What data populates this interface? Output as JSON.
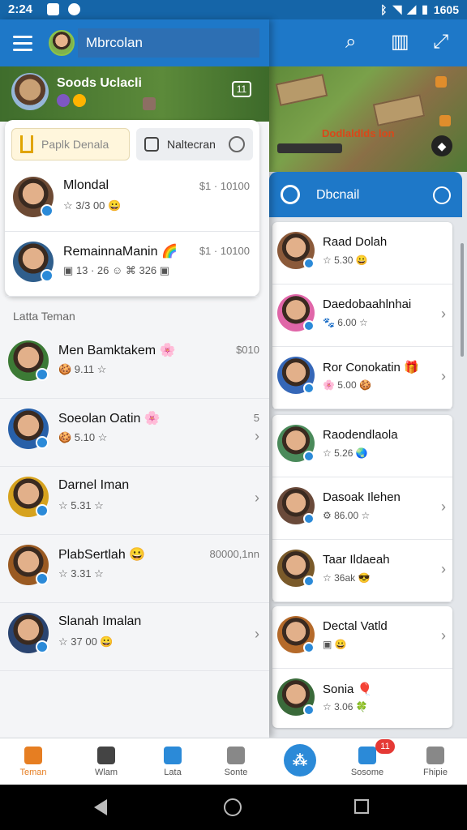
{
  "status_bar": {
    "time": "2:24",
    "right_text": "1605"
  },
  "drawer": {
    "search_text": "Mbrcolan",
    "banner_title": "Soods Uclacli",
    "banner_badge": "11",
    "tabs": [
      {
        "label": "Paplk Denala"
      },
      {
        "label": "Naltecran"
      }
    ],
    "pinned": [
      {
        "name": "Mlondal",
        "meta": "☆ 3/3 00 😀",
        "right": "$1 · 10100",
        "avatar_color": "#6d4a34"
      },
      {
        "name": "RemainnaManin 🌈",
        "meta": "▣ 13 · 26 ☺ ⌘ 326 ▣",
        "right": "$1 · 10100",
        "avatar_color": "#2f5e8c"
      }
    ],
    "section_label": "Latta Teman",
    "friends": [
      {
        "name": "Men Bamktakem 🌸",
        "meta": "🍪 9.11 ☆",
        "right": "$010",
        "chevron": false,
        "avatar_color": "#3c7a35"
      },
      {
        "name": "Soeolan Oatin 🌸",
        "meta": "🍪 5.10 ☆",
        "right": "5",
        "chevron": true,
        "avatar_color": "#2860a8"
      },
      {
        "name": "Darnel Iman",
        "meta": "☆ 5.31 ☆",
        "right": "",
        "chevron": true,
        "avatar_color": "#d6a21e"
      },
      {
        "name": "PlabSertlah 😀",
        "meta": "☆ 3.31 ☆",
        "right": "80000,1nn",
        "chevron": false,
        "avatar_color": "#9a5a22"
      },
      {
        "name": "Slanah Imalan",
        "meta": "☆ 37 00 😀",
        "right": "",
        "chevron": true,
        "avatar_color": "#2a4470"
      }
    ]
  },
  "right_panel": {
    "title": "Dbcnail",
    "game_text": "Dodlaldlds lon",
    "card1": [
      {
        "name": "Raad Dolah",
        "meta": "☆ 5.30 😀",
        "chevron": false,
        "avatar_color": "#8b5a3a"
      },
      {
        "name": "Daedobaahlnhai",
        "meta": "🐾 6.00 ☆",
        "chevron": true,
        "avatar_color": "#e066a8"
      },
      {
        "name": "Ror Conokatin 🎁",
        "meta": "🌸 5.00 🍪",
        "chevron": true,
        "avatar_color": "#3567b8"
      }
    ],
    "card2": [
      {
        "name": "Raodendlaola",
        "meta": "☆ 5.26 🌏",
        "chevron": false,
        "avatar_color": "#4a8a5a"
      },
      {
        "name": "Dasoak Ilehen",
        "meta": "⚙ 86.00 ☆",
        "chevron": true,
        "avatar_color": "#6a4a3a"
      },
      {
        "name": "Taar Ildaeah",
        "meta": "☆ 36ak 😎",
        "chevron": true,
        "avatar_color": "#7a5a2a"
      }
    ],
    "card3": [
      {
        "name": "Dectal Vatld",
        "meta": "▣ 😀",
        "chevron": true,
        "avatar_color": "#b56a2a"
      },
      {
        "name": "Sonia 🎈",
        "meta": "☆ 3.06 🍀",
        "chevron": false,
        "avatar_color": "#3a6a3a"
      }
    ]
  },
  "bottom_nav": {
    "items": [
      {
        "label": "Teman",
        "color": "#e67e22"
      },
      {
        "label": "Wlam",
        "color": "#444"
      },
      {
        "label": "Lata",
        "color": "#2b8ad8"
      },
      {
        "label": "Sonte",
        "color": "#888"
      },
      {
        "label": "Sosome",
        "color": "#2b8ad8"
      },
      {
        "label": "Fhipie",
        "color": "#888"
      }
    ],
    "fab_label": "⁂",
    "notif_count": "11"
  },
  "colors": {
    "primary": "#1e78c8",
    "accent": "#e67e22",
    "verified": "#2b8ad8"
  }
}
